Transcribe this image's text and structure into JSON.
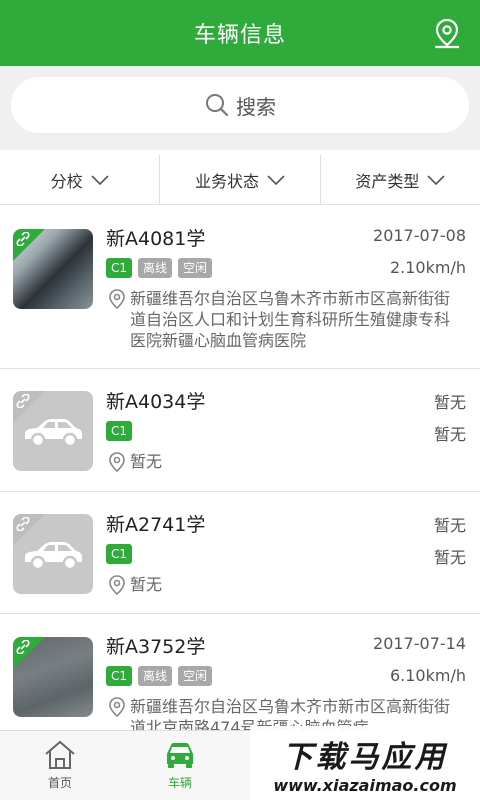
{
  "header": {
    "title": "车辆信息",
    "location_icon": "location-pin-icon"
  },
  "search": {
    "label": "搜索",
    "icon": "search-icon"
  },
  "filters": [
    {
      "label": "分校"
    },
    {
      "label": "业务状态"
    },
    {
      "label": "资产类型"
    }
  ],
  "vehicles": [
    {
      "plate": "新A4081学",
      "date": "2017-07-08",
      "speed": "2.10km/h",
      "badges": [
        "C1",
        "离线",
        "空闲"
      ],
      "address": "新疆维吾尔自治区乌鲁木齐市新市区高新街街道自治区人口和计划生育科研所生殖健康专科医院新疆心脑血管病医院"
    },
    {
      "plate": "新A4034学",
      "date": "暂无",
      "speed": "暂无",
      "badges": [
        "C1"
      ],
      "address": "暂无"
    },
    {
      "plate": "新A2741学",
      "date": "暂无",
      "speed": "暂无",
      "badges": [
        "C1"
      ],
      "address": "暂无"
    },
    {
      "plate": "新A3752学",
      "date": "2017-07-14",
      "speed": "6.10km/h",
      "badges": [
        "C1",
        "离线",
        "空闲"
      ],
      "address": "新疆维吾尔自治区乌鲁木齐市新市区高新街街道北京南路474号新疆心脑血管病"
    }
  ],
  "tabbar": [
    {
      "label": "首页",
      "icon": "home-icon"
    },
    {
      "label": "车辆",
      "icon": "car-icon"
    }
  ],
  "watermark": {
    "main": "下载马应用",
    "url": "www.xiazaimao.com"
  },
  "colors": {
    "brand_green": "#2eab3a",
    "badge_gray": "#a8a8a8"
  }
}
